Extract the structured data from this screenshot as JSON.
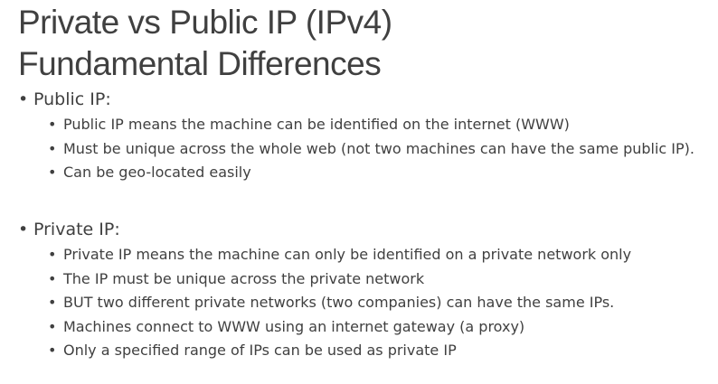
{
  "slide": {
    "title_line1": "Private vs Public IP (IPv4)",
    "title_line2": "Fundamental Differences",
    "bullet_char": "•",
    "sections": [
      {
        "heading": "Public IP:",
        "items": [
          "Public IP means the machine can be identified on the internet (WWW)",
          "Must be unique across the whole web (not two machines can have the same public IP).",
          "Can be geo-located easily"
        ]
      },
      {
        "heading": "Private IP:",
        "items": [
          "Private IP means the machine can only be identified on a private network only",
          "The IP must be unique across the private network",
          "BUT two different private networks (two companies) can have the same IPs.",
          "Machines connect to WWW using an internet gateway (a proxy)",
          "Only a specified range of IPs can be used as private IP"
        ]
      }
    ]
  }
}
